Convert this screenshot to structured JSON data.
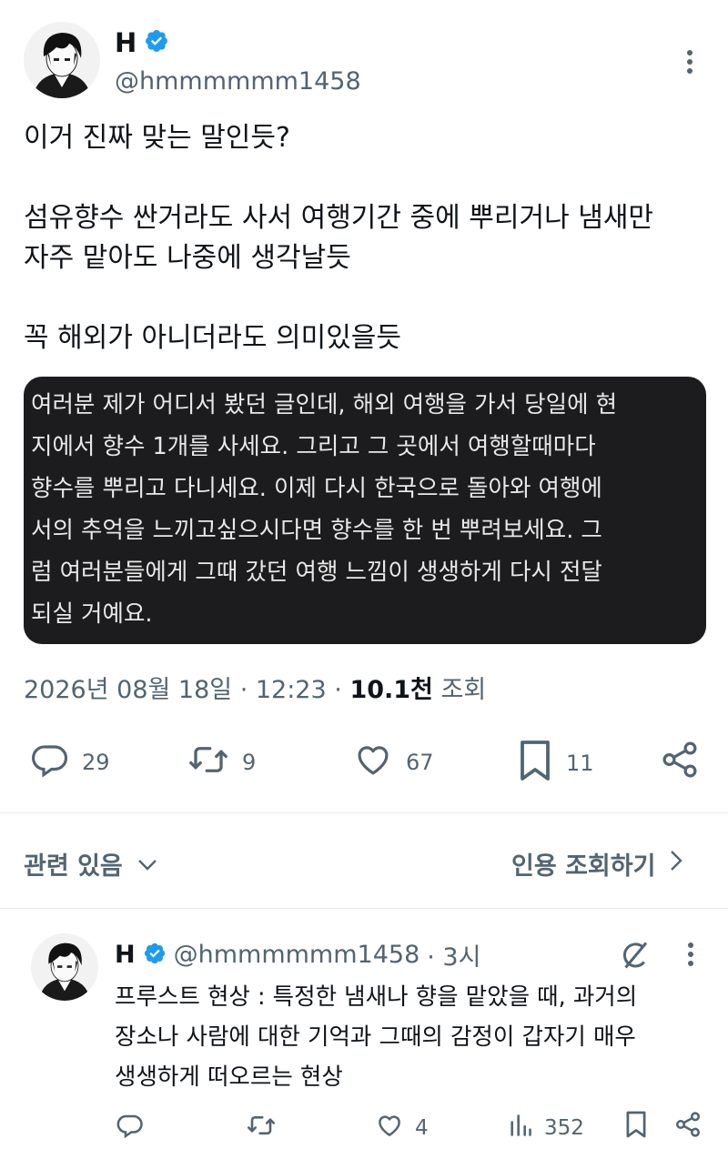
{
  "tweet": {
    "author_name": "H",
    "author_handle": "@hmmmmmm1458",
    "text": "이거 진짜 맞는 말인듯?\n\n섬유향수 싼거라도 사서 여행기간 중에 뿌리거나 냄새만\n자주 맡아도 나중에 생각날듯\n\n꼭 해외가 아니더라도 의미있을듯",
    "quote_text": "여러분 제가 어디서 봤던 글인데, 해외 여행을 가서 당일에 현\n지에서 향수 1개를 사세요. 그리고 그 곳에서 여행할때마다\n향수를 뿌리고 다니세요. 이제 다시 한국으로 돌아와 여행에\n서의 추억을 느끼고싶으시다면 향수를 한 번 뿌려보세요. 그\n럼 여러분들에게 그때 갔던 여행 느낌이 생생하게 다시 전달\n되실 거예요.",
    "timestamp": "2026년 08월 18일 · 12:23 ·",
    "views_count": "10.1천",
    "views_label": "조회",
    "replies": "29",
    "retweets": "9",
    "likes": "67",
    "bookmarks": "11"
  },
  "related": {
    "label": "관련 있음",
    "quote_views": "인용 조회하기"
  },
  "reply": {
    "author_name": "H",
    "author_handle": "@hmmmmmm1458",
    "time": "· 3시",
    "text": "프루스트 현상 : 특정한 냄새나 향을 맡았을 때, 과거의\n장소나 사람에 대한 기억과 그때의 감정이 갑자기 매우\n생생하게 떠오르는 현상",
    "likes": "4",
    "views": "352"
  },
  "colors": {
    "verified": "#1d9bf0",
    "muted": "#536471",
    "quote_bg": "#1c1c1e"
  },
  "icons": [
    "more-icon",
    "verified-icon",
    "reply-icon",
    "retweet-icon",
    "like-icon",
    "bookmark-icon",
    "share-icon",
    "chevron-down-icon",
    "chevron-right-icon",
    "grok-icon",
    "views-icon"
  ]
}
